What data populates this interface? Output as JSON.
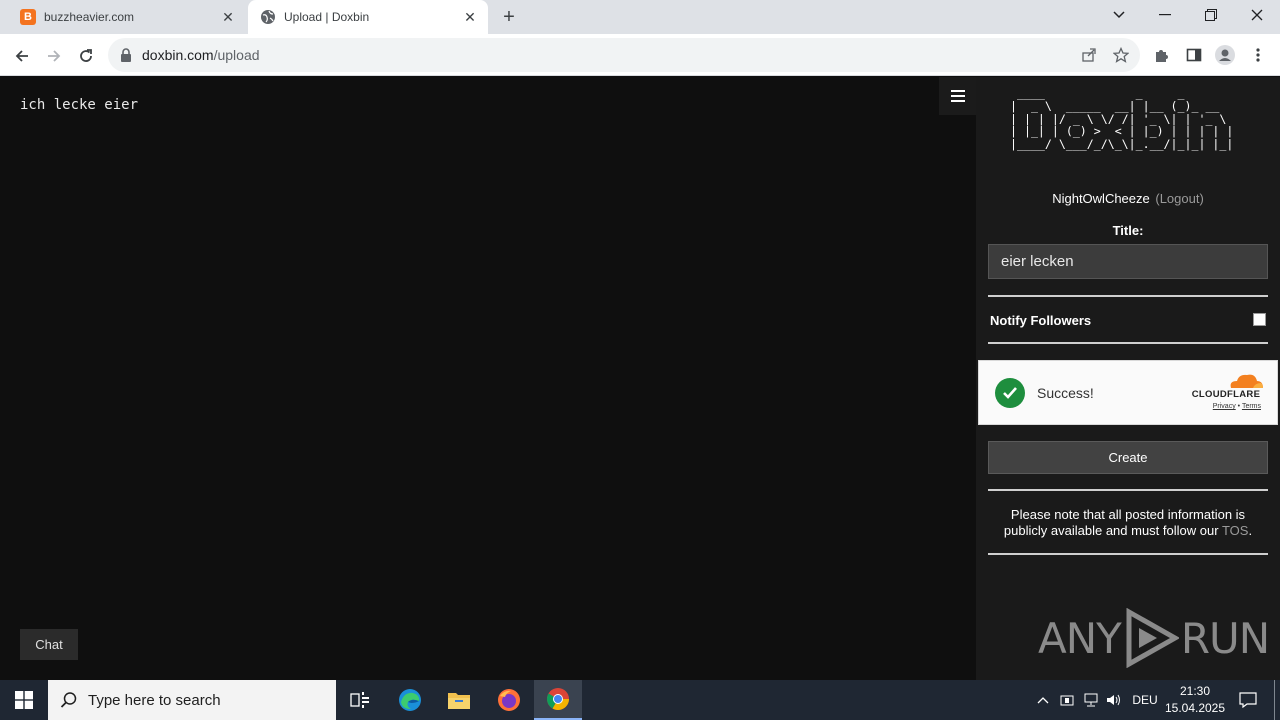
{
  "browser": {
    "tabs": [
      {
        "title": "buzzheavier.com",
        "favicon_letter": "B",
        "favicon_color": "#f4731f",
        "active": false
      },
      {
        "title": "Upload | Doxbin",
        "active": true
      }
    ],
    "url_host": "doxbin.com",
    "url_path": "/upload"
  },
  "editor": {
    "content": "ich lecke eier",
    "chat_label": "Chat"
  },
  "sidebar": {
    "logo_ascii": " ____             _     _\n|  _ \\  _____  __| |__ (_)_ __\n| | | |/ _ \\ \\/ /| '_ \\| | '_ \\\n| |_| | (_) >  < | |_) | | | | |\n|____/ \\___/_/\\_\\|_.__/|_|_| |_|",
    "username": "NightOwlCheeze",
    "logout_label": "(Logout)",
    "title_label": "Title:",
    "title_value": "eier lecken",
    "notify_label": "Notify Followers",
    "notify_checked": false,
    "captcha": {
      "status": "Success!",
      "brand": "CLOUDFLARE",
      "privacy": "Privacy",
      "separator": "•",
      "terms": "Terms"
    },
    "create_label": "Create",
    "notice_text": "Please note that all posted information is publicly available and must follow our",
    "tos_label": "TOS",
    "notice_end": ".",
    "watermark_left": "ANY",
    "watermark_right": "RUN"
  },
  "taskbar": {
    "search_placeholder": "Type here to search",
    "language": "DEU",
    "time": "21:30",
    "date": "15.04.2025"
  },
  "colors": {
    "page_bg": "#0f0f0f",
    "sidebar_bg": "#1a1a1a",
    "captcha_check": "#1e8e3e",
    "cloudflare_orange": "#f38020"
  }
}
